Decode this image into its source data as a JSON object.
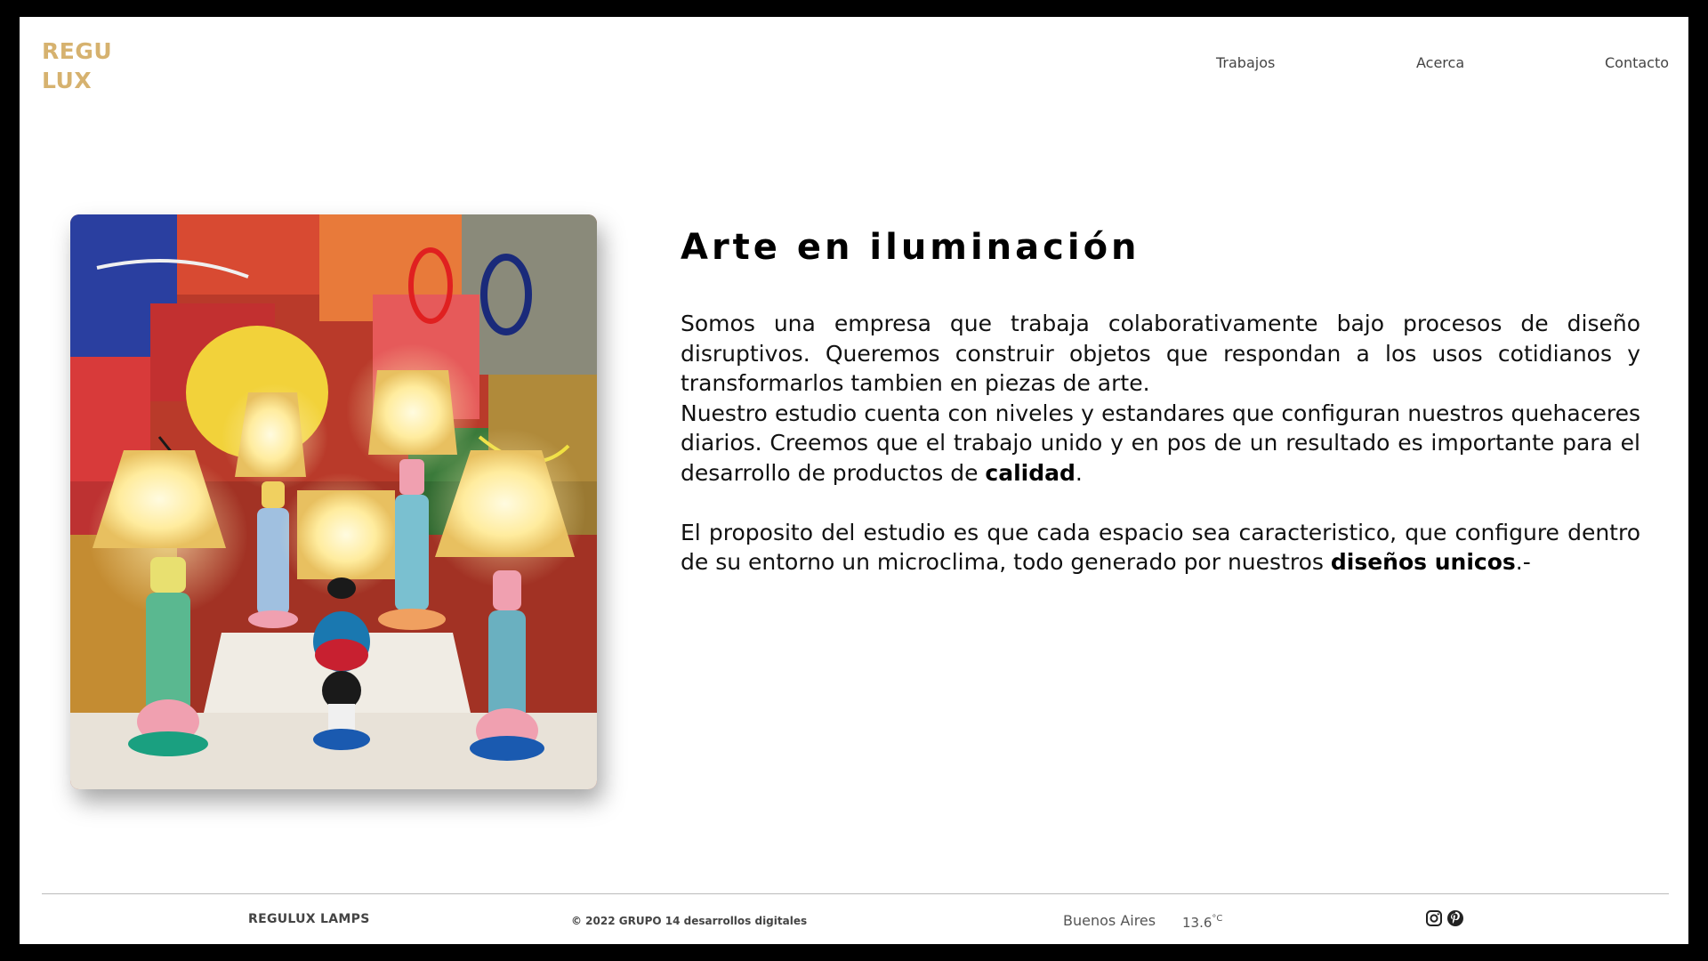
{
  "header": {
    "logo_line1": "REGU",
    "logo_line2": "LUX",
    "nav": [
      "Trabajos",
      "Acerca",
      "Contacto"
    ]
  },
  "main": {
    "headline": "Arte en iluminación",
    "p1_text": "Somos una empresa que trabaja colaborativamente bajo procesos de diseño disruptivos. Queremos construir objetos que respondan a los usos cotidianos y transformarlos tambien en piezas de arte.",
    "p2_text": "Nuestro estudio cuenta con niveles y estandares que configuran nuestros quehaceres diarios. Creemos que el trabajo unido y en pos de un resultado es importante para el desarrollo de productos de ",
    "p2_bold": "calidad",
    "p2_end": ".",
    "p3_text": "El proposito del estudio es que cada espacio sea caracteristico, que configure dentro de su entorno un microclima, todo generado por nuestros ",
    "p3_bold": "diseños unicos",
    "p3_end": ".-"
  },
  "footer": {
    "brand": "REGULUX LAMPS",
    "copyright": "© 2022 GRUPO 14 desarrollos digitales",
    "city": "Buenos Aires",
    "temp_value": "13.6",
    "temp_unit": "°C",
    "social_icons": [
      "instagram-icon",
      "pinterest-icon"
    ]
  },
  "colors": {
    "logo": "#d6b26f",
    "page_bg": "#ffffff",
    "frame": "#000000"
  }
}
